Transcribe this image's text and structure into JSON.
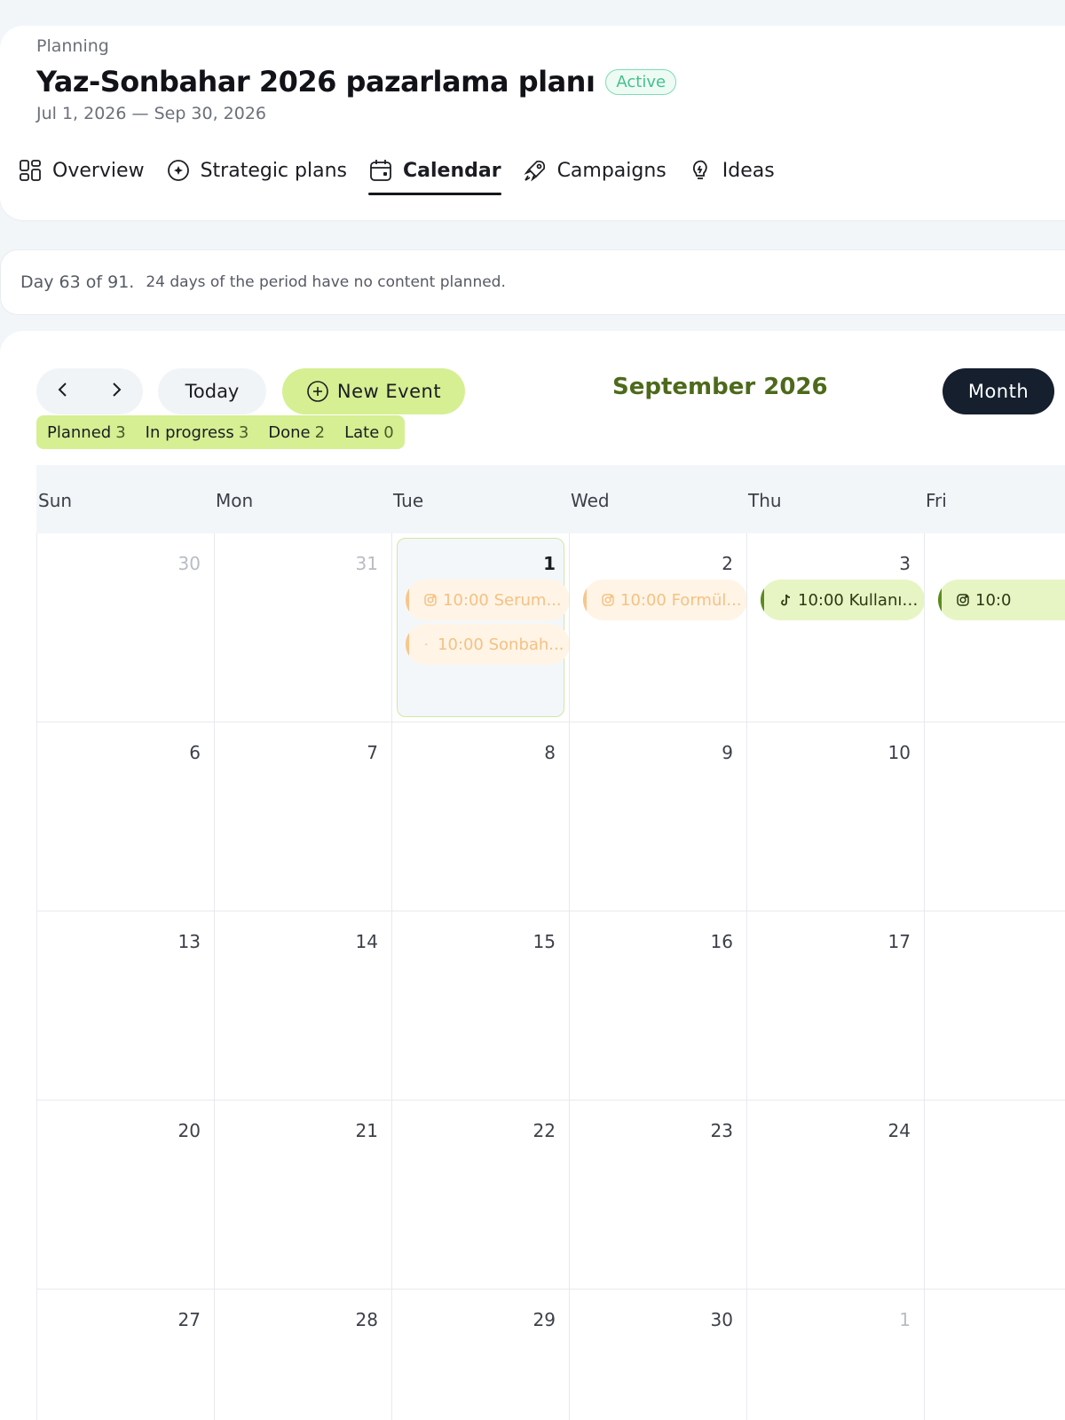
{
  "header": {
    "breadcrumb": "Planning",
    "title": "Yaz-Sonbahar 2026 pazarlama planı",
    "status": "Active",
    "date_range": "Jul 1, 2026 — Sep 30, 2026"
  },
  "tabs": [
    {
      "label": "Overview",
      "icon": "grid-icon",
      "active": false
    },
    {
      "label": "Strategic plans",
      "icon": "compass-icon",
      "active": false
    },
    {
      "label": "Calendar",
      "icon": "calendar-icon",
      "active": true
    },
    {
      "label": "Campaigns",
      "icon": "rocket-icon",
      "active": false
    },
    {
      "label": "Ideas",
      "icon": "lightbulb-icon",
      "active": false
    }
  ],
  "info": {
    "day": "Day 63 of 91.",
    "note": "24 days of the period have no content planned."
  },
  "toolbar": {
    "today_label": "Today",
    "new_event_label": "New Event",
    "month_title": "September 2026",
    "view_label": "Month"
  },
  "status_counts": [
    {
      "label": "Planned",
      "count": "3"
    },
    {
      "label": "In progress",
      "count": "3"
    },
    {
      "label": "Done",
      "count": "2"
    },
    {
      "label": "Late",
      "count": "0"
    }
  ],
  "weekdays": [
    "Sun",
    "Mon",
    "Tue",
    "Wed",
    "Thu",
    "Fri"
  ],
  "weeks": [
    [
      "30",
      "31",
      "1",
      "2",
      "3",
      ""
    ],
    [
      "6",
      "7",
      "8",
      "9",
      "10",
      ""
    ],
    [
      "13",
      "14",
      "15",
      "16",
      "17",
      ""
    ],
    [
      "20",
      "21",
      "22",
      "23",
      "24",
      ""
    ],
    [
      "27",
      "28",
      "29",
      "30",
      "1",
      ""
    ]
  ],
  "events": {
    "tue_1_a": "10:00 Serum...",
    "tue_1_b": "10:00 Sonbah...",
    "wed_2": "10:00 Formül...",
    "thu_3": "10:00 Kullanıc...",
    "fri_4": "10:0"
  },
  "colors": {
    "accent_lime": "#d6ef93",
    "month_title": "#4d6a1b",
    "active_badge": "#45c08c",
    "dark_button": "#151f2e"
  }
}
